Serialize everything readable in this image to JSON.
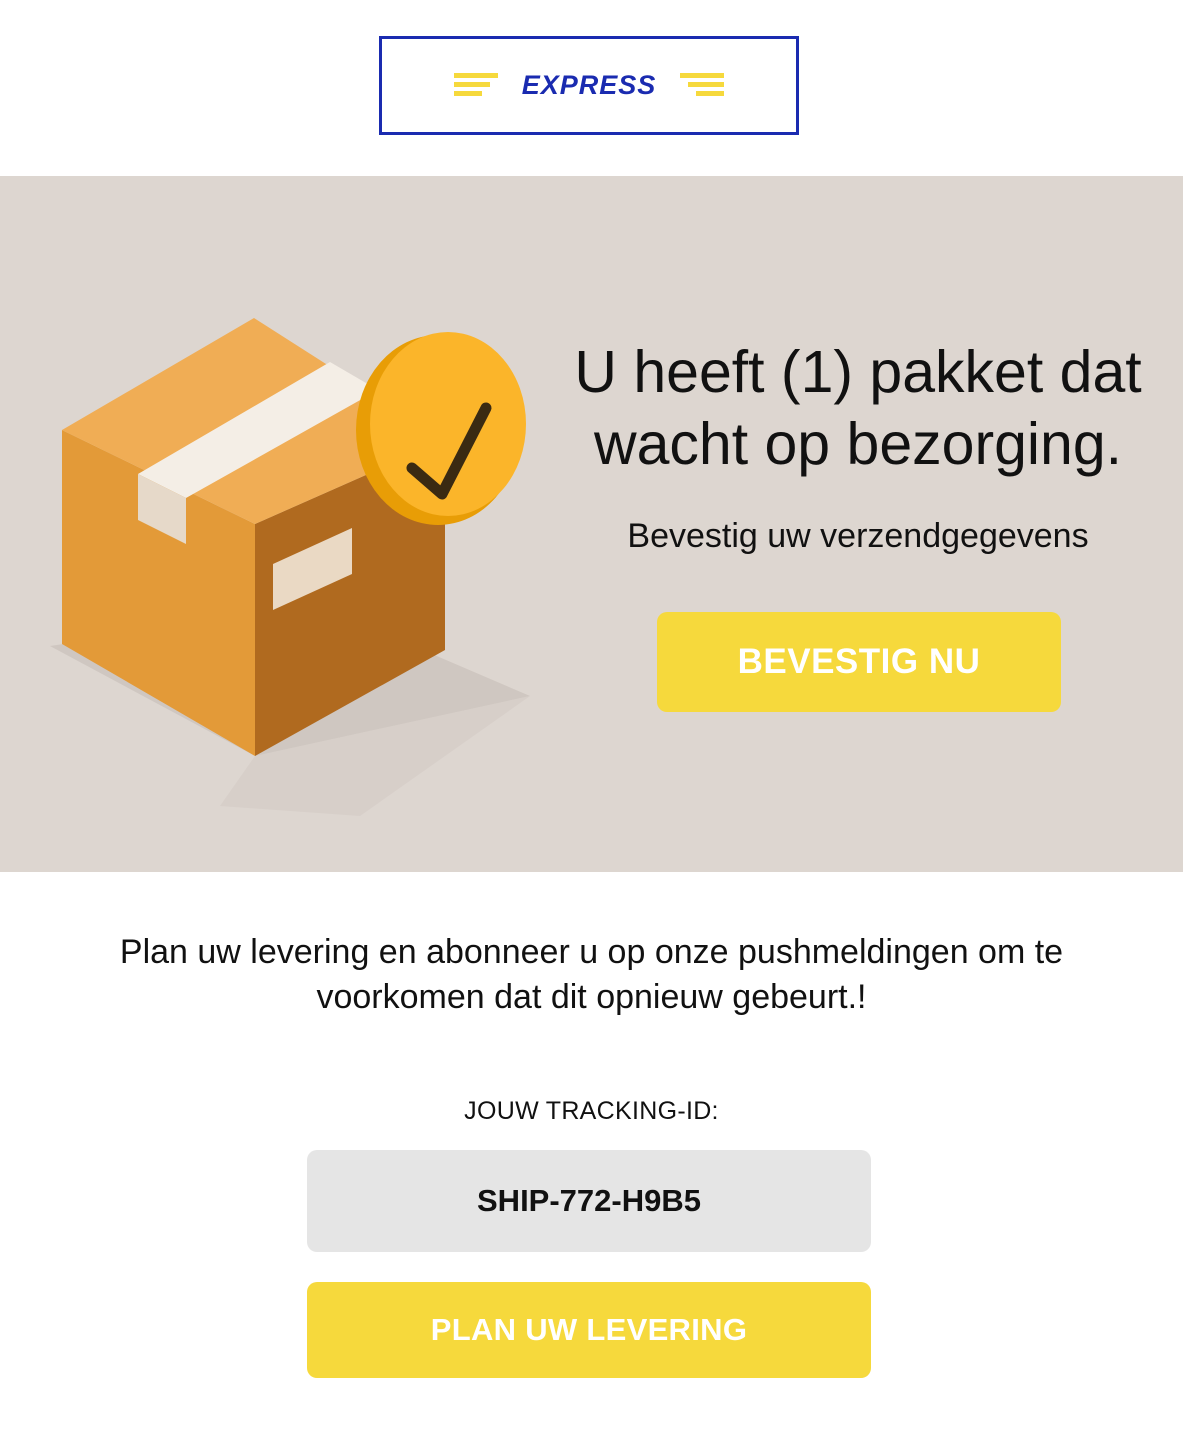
{
  "header": {
    "logo_text": "EXPRESS",
    "logo_icon": "express-logo",
    "brand_colors": {
      "border": "#1a2bb0",
      "text": "#1a2bb0",
      "stripes": "#f6d93c"
    }
  },
  "hero": {
    "title": "U heeft (1) pakket dat wacht op bezorging.",
    "subtitle": "Bevestig uw verzendgegevens",
    "confirm_button_label": "BEVESTIG NU",
    "illustration": "package-box-with-checkmark-icon",
    "background_color": "#ddd6d0"
  },
  "main": {
    "message": "Plan uw levering en abonneer u op onze pushmeldingen om te voorkomen dat dit opnieuw gebeurt.!",
    "tracking_label": "JOUW TRACKING-ID:",
    "tracking_id": "SHIP-772-H9B5",
    "plan_button_label": "PLAN UW LEVERING"
  },
  "colors": {
    "accent_yellow": "#f6d93c",
    "tracking_box_bg": "#e5e5e5"
  }
}
